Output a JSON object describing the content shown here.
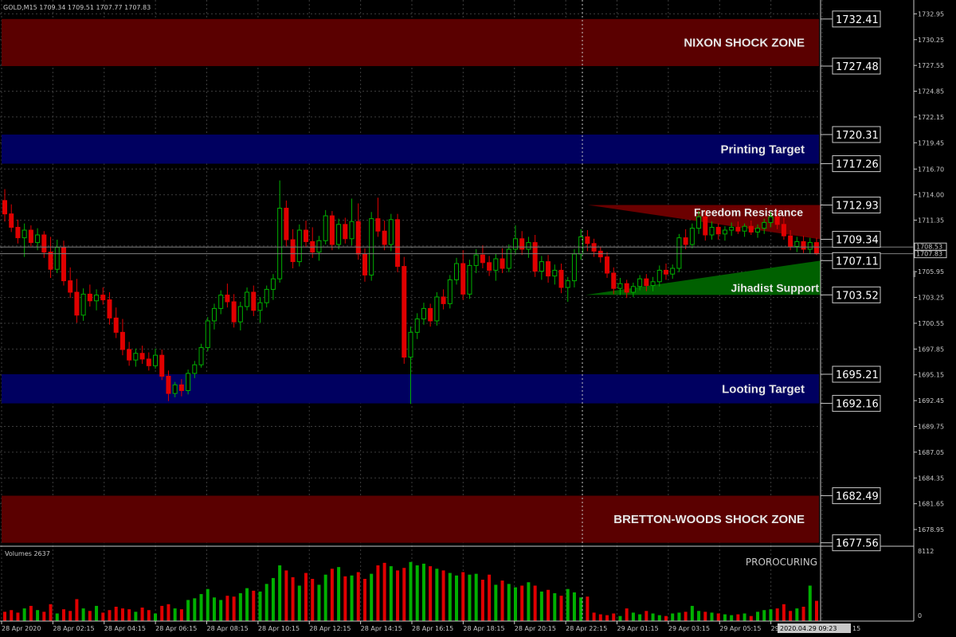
{
  "header": {
    "symbol_info": "GOLD,M15  1709.34 1709.51 1707.77 1707.83"
  },
  "volume_panel": {
    "title": "Volumes 2637",
    "max_label": "8112",
    "zero_label": "0",
    "indicator_label": "PROROCURING"
  },
  "price_axis": {
    "ticks": [
      "1732.95",
      "1730.25",
      "1727.55",
      "1724.85",
      "1722.15",
      "1719.45",
      "1716.70",
      "1714.00",
      "1711.35",
      "1708.65",
      "1705.95",
      "1703.25",
      "1700.55",
      "1697.85",
      "1695.15",
      "1692.45",
      "1689.75",
      "1687.05",
      "1684.35",
      "1681.65",
      "1678.95"
    ],
    "tick_values": [
      1732.95,
      1730.25,
      1727.55,
      1724.85,
      1722.15,
      1719.45,
      1716.7,
      1714.0,
      1711.35,
      1708.65,
      1705.95,
      1703.25,
      1700.55,
      1697.85,
      1695.15,
      1692.45,
      1689.75,
      1687.05,
      1684.35,
      1681.65,
      1678.95
    ],
    "current_bid": "1708.53",
    "current_ask": "1707.83",
    "range": [
      1677.2,
      1734.4
    ]
  },
  "time_axis": {
    "labels": [
      "28 Apr 2020",
      "28 Apr 02:15",
      "28 Apr 04:15",
      "28 Apr 06:15",
      "28 Apr 08:15",
      "28 Apr 10:15",
      "28 Apr 12:15",
      "28 Apr 14:15",
      "28 Apr 16:15",
      "28 Apr 18:15",
      "28 Apr 20:15",
      "28 Apr 22:15",
      "29 Apr 01:15",
      "29 Apr 03:15",
      "29 Apr 05:15",
      "29 Apr"
    ],
    "cursor_time": "2020.04.29 09:23",
    "trailing": "15"
  },
  "zones": [
    {
      "name": "NIXON SHOCK ZONE",
      "top": 1732.41,
      "bottom": 1727.48,
      "top_label": "1732.41",
      "bottom_label": "1727.48",
      "color": "#5a0000"
    },
    {
      "name": "Printing Target",
      "top": 1720.31,
      "bottom": 1717.26,
      "top_label": "1720.31",
      "bottom_label": "1717.26",
      "color": "#000060"
    },
    {
      "name": "Looting Target",
      "top": 1695.21,
      "bottom": 1692.16,
      "top_label": "1695.21",
      "bottom_label": "1692.16",
      "color": "#000060"
    },
    {
      "name": "BRETTON-WOODS SHOCK ZONE",
      "top": 1682.49,
      "bottom": 1677.56,
      "top_label": "1682.49",
      "bottom_label": "1677.56",
      "color": "#5a0000"
    }
  ],
  "triangles": [
    {
      "name": "Freedom Resistance",
      "top": 1712.93,
      "top_label": "1712.93",
      "mid": 1709.34,
      "mid_label": "1709.34",
      "color": "#6b0000"
    },
    {
      "name": "Jihadist Support",
      "bottom": 1703.52,
      "bottom_label": "1703.52",
      "mid": 1707.11,
      "mid_label": "1707.11",
      "color": "#006000"
    }
  ],
  "chart_data": {
    "type": "candlestick",
    "title": "GOLD,M15",
    "timeframe": "M15",
    "ylim": [
      1677.2,
      1734.4
    ],
    "ohlc": [
      [
        1713.4,
        1714.6,
        1711.2,
        1712.0
      ],
      [
        1712.0,
        1713.0,
        1710.1,
        1710.6
      ],
      [
        1710.6,
        1711.4,
        1708.9,
        1709.5
      ],
      [
        1709.5,
        1711.0,
        1707.5,
        1710.3
      ],
      [
        1710.3,
        1710.8,
        1708.6,
        1709.0
      ],
      [
        1709.0,
        1710.5,
        1708.2,
        1709.8
      ],
      [
        1709.8,
        1710.2,
        1707.4,
        1708.0
      ],
      [
        1708.0,
        1709.6,
        1705.3,
        1706.2
      ],
      [
        1706.2,
        1709.3,
        1705.8,
        1708.5
      ],
      [
        1708.5,
        1709.2,
        1704.5,
        1705.0
      ],
      [
        1705.0,
        1706.4,
        1703.2,
        1703.8
      ],
      [
        1703.8,
        1705.2,
        1700.6,
        1701.4
      ],
      [
        1701.4,
        1704.2,
        1700.8,
        1703.6
      ],
      [
        1703.6,
        1704.6,
        1702.3,
        1702.9
      ],
      [
        1702.9,
        1704.1,
        1701.9,
        1703.5
      ],
      [
        1703.5,
        1704.3,
        1702.5,
        1703.0
      ],
      [
        1703.0,
        1703.8,
        1700.4,
        1701.1
      ],
      [
        1701.1,
        1702.2,
        1699.0,
        1699.6
      ],
      [
        1699.6,
        1701.0,
        1697.2,
        1697.8
      ],
      [
        1697.8,
        1698.6,
        1696.1,
        1696.7
      ],
      [
        1696.7,
        1697.9,
        1696.0,
        1697.4
      ],
      [
        1697.4,
        1698.2,
        1696.3,
        1696.8
      ],
      [
        1696.8,
        1697.5,
        1695.6,
        1696.1
      ],
      [
        1696.1,
        1697.9,
        1695.8,
        1697.2
      ],
      [
        1697.2,
        1697.8,
        1694.6,
        1695.0
      ],
      [
        1695.0,
        1695.6,
        1692.4,
        1693.2
      ],
      [
        1693.2,
        1694.4,
        1692.8,
        1694.1
      ],
      [
        1694.1,
        1694.7,
        1692.9,
        1693.5
      ],
      [
        1693.5,
        1695.7,
        1693.1,
        1695.3
      ],
      [
        1695.3,
        1696.6,
        1694.8,
        1696.2
      ],
      [
        1696.2,
        1698.4,
        1695.9,
        1698.0
      ],
      [
        1698.0,
        1701.2,
        1697.6,
        1700.8
      ],
      [
        1700.8,
        1702.6,
        1699.9,
        1702.1
      ],
      [
        1702.1,
        1704.0,
        1701.5,
        1703.5
      ],
      [
        1703.5,
        1704.7,
        1702.2,
        1702.8
      ],
      [
        1702.8,
        1703.6,
        1700.1,
        1700.7
      ],
      [
        1700.7,
        1702.8,
        1699.8,
        1702.3
      ],
      [
        1702.3,
        1704.3,
        1701.9,
        1703.8
      ],
      [
        1703.8,
        1704.5,
        1701.3,
        1701.9
      ],
      [
        1701.9,
        1703.3,
        1700.6,
        1702.7
      ],
      [
        1702.7,
        1704.5,
        1702.2,
        1704.1
      ],
      [
        1704.1,
        1705.7,
        1703.0,
        1705.2
      ],
      [
        1705.2,
        1715.5,
        1704.8,
        1712.6
      ],
      [
        1712.6,
        1713.4,
        1708.6,
        1709.3
      ],
      [
        1709.3,
        1710.4,
        1706.3,
        1707.0
      ],
      [
        1707.0,
        1710.9,
        1706.5,
        1710.3
      ],
      [
        1710.3,
        1711.3,
        1708.5,
        1709.1
      ],
      [
        1709.1,
        1710.6,
        1707.4,
        1708.0
      ],
      [
        1708.0,
        1709.7,
        1707.1,
        1709.2
      ],
      [
        1709.2,
        1712.4,
        1708.8,
        1711.8
      ],
      [
        1711.8,
        1712.3,
        1708.2,
        1708.8
      ],
      [
        1708.8,
        1711.5,
        1708.3,
        1710.9
      ],
      [
        1710.9,
        1711.6,
        1708.9,
        1709.4
      ],
      [
        1709.4,
        1713.6,
        1708.7,
        1711.2
      ],
      [
        1711.2,
        1713.1,
        1707.2,
        1707.8
      ],
      [
        1707.8,
        1708.4,
        1704.9,
        1705.6
      ],
      [
        1705.6,
        1712.2,
        1705.0,
        1711.5
      ],
      [
        1711.5,
        1713.7,
        1709.6,
        1710.2
      ],
      [
        1710.2,
        1711.3,
        1708.2,
        1708.8
      ],
      [
        1708.8,
        1712.0,
        1708.1,
        1711.4
      ],
      [
        1711.4,
        1712.0,
        1705.9,
        1706.5
      ],
      [
        1706.5,
        1707.5,
        1696.3,
        1697.0
      ],
      [
        1697.0,
        1700.2,
        1692.1,
        1699.6
      ],
      [
        1699.6,
        1701.6,
        1698.9,
        1701.0
      ],
      [
        1701.0,
        1702.7,
        1700.4,
        1702.1
      ],
      [
        1702.1,
        1702.6,
        1700.2,
        1700.8
      ],
      [
        1700.8,
        1703.8,
        1700.3,
        1703.3
      ],
      [
        1703.3,
        1704.1,
        1702.0,
        1702.6
      ],
      [
        1702.6,
        1705.6,
        1702.1,
        1705.1
      ],
      [
        1705.1,
        1707.4,
        1704.6,
        1706.8
      ],
      [
        1706.8,
        1708.2,
        1703.0,
        1703.6
      ],
      [
        1703.6,
        1707.2,
        1703.1,
        1706.6
      ],
      [
        1706.6,
        1708.3,
        1705.8,
        1707.7
      ],
      [
        1707.7,
        1708.7,
        1706.3,
        1706.9
      ],
      [
        1706.9,
        1707.6,
        1705.5,
        1706.1
      ],
      [
        1706.1,
        1707.8,
        1705.0,
        1707.3
      ],
      [
        1707.3,
        1708.4,
        1705.8,
        1706.3
      ],
      [
        1706.3,
        1708.8,
        1705.9,
        1708.3
      ],
      [
        1708.3,
        1710.8,
        1707.7,
        1709.4
      ],
      [
        1709.4,
        1710.2,
        1707.7,
        1708.3
      ],
      [
        1708.3,
        1709.6,
        1707.4,
        1709.0
      ],
      [
        1709.0,
        1709.8,
        1705.4,
        1706.0
      ],
      [
        1706.0,
        1707.6,
        1705.1,
        1707.0
      ],
      [
        1707.0,
        1707.7,
        1704.8,
        1705.5
      ],
      [
        1705.5,
        1706.7,
        1704.6,
        1706.1
      ],
      [
        1706.1,
        1706.8,
        1703.7,
        1704.3
      ],
      [
        1704.3,
        1705.4,
        1702.8,
        1705.0
      ],
      [
        1705.0,
        1708.3,
        1704.3,
        1707.8
      ],
      [
        1707.8,
        1710.4,
        1707.2,
        1709.6
      ],
      [
        1709.6,
        1710.3,
        1708.1,
        1708.9
      ],
      [
        1708.9,
        1709.4,
        1707.5,
        1708.1
      ],
      [
        1708.1,
        1708.6,
        1706.9,
        1707.5
      ],
      [
        1707.5,
        1708.0,
        1705.3,
        1705.8
      ],
      [
        1705.8,
        1706.4,
        1703.6,
        1704.2
      ],
      [
        1704.2,
        1705.3,
        1703.5,
        1704.7
      ],
      [
        1704.7,
        1705.1,
        1703.2,
        1703.8
      ],
      [
        1703.8,
        1704.8,
        1703.3,
        1704.4
      ],
      [
        1704.4,
        1705.6,
        1704.0,
        1705.2
      ],
      [
        1705.2,
        1705.7,
        1703.9,
        1704.5
      ],
      [
        1704.5,
        1705.4,
        1703.9,
        1704.9
      ],
      [
        1704.9,
        1706.6,
        1704.4,
        1706.1
      ],
      [
        1706.1,
        1706.8,
        1705.1,
        1705.7
      ],
      [
        1705.7,
        1706.7,
        1705.2,
        1706.3
      ],
      [
        1706.3,
        1709.9,
        1705.9,
        1709.5
      ],
      [
        1709.5,
        1710.4,
        1708.3,
        1708.8
      ],
      [
        1708.8,
        1711.0,
        1708.4,
        1710.5
      ],
      [
        1710.5,
        1712.3,
        1709.9,
        1711.7
      ],
      [
        1711.7,
        1712.4,
        1709.2,
        1709.8
      ],
      [
        1709.8,
        1711.2,
        1709.3,
        1710.6
      ],
      [
        1710.6,
        1711.0,
        1709.3,
        1709.9
      ],
      [
        1709.9,
        1710.7,
        1709.2,
        1710.3
      ],
      [
        1710.3,
        1711.1,
        1709.7,
        1710.6
      ],
      [
        1710.6,
        1711.2,
        1709.9,
        1710.2
      ],
      [
        1710.2,
        1711.0,
        1709.6,
        1710.7
      ],
      [
        1710.7,
        1711.3,
        1709.8,
        1710.1
      ],
      [
        1710.1,
        1710.9,
        1709.5,
        1710.5
      ],
      [
        1710.5,
        1711.5,
        1709.9,
        1711.1
      ],
      [
        1711.1,
        1712.2,
        1710.6,
        1711.7
      ],
      [
        1711.7,
        1712.4,
        1710.4,
        1710.9
      ],
      [
        1710.9,
        1711.6,
        1709.3,
        1709.7
      ],
      [
        1709.7,
        1710.3,
        1708.2,
        1708.6
      ],
      [
        1708.6,
        1709.6,
        1708.0,
        1709.1
      ],
      [
        1709.1,
        1709.7,
        1707.9,
        1708.3
      ],
      [
        1708.3,
        1709.5,
        1707.8,
        1709.0
      ],
      [
        1709.0,
        1709.5,
        1707.7,
        1707.83
      ]
    ],
    "volumes": [
      1100,
      1300,
      1000,
      1500,
      1800,
      1300,
      1100,
      2000,
      900,
      1400,
      1200,
      2600,
      1500,
      1200,
      1800,
      1000,
      1300,
      1700,
      1500,
      1400,
      1100,
      1600,
      1300,
      900,
      1800,
      2000,
      1500,
      1400,
      2500,
      2700,
      3200,
      3800,
      2800,
      2500,
      3000,
      2900,
      3300,
      3900,
      3600,
      3500,
      4400,
      5100,
      6600,
      6000,
      5200,
      4200,
      5700,
      5000,
      4300,
      5500,
      6200,
      6400,
      5300,
      5400,
      5800,
      5000,
      5600,
      6600,
      6900,
      6500,
      6000,
      6300,
      7000,
      6600,
      6800,
      6500,
      6200,
      6000,
      5700,
      5400,
      5800,
      5500,
      5600,
      4900,
      5500,
      4300,
      4800,
      4400,
      4000,
      4200,
      4600,
      4200,
      3500,
      3700,
      3300,
      3000,
      3800,
      3400,
      2800,
      2900,
      1000,
      800,
      700,
      900,
      600,
      1500,
      1000,
      800,
      1200,
      900,
      700,
      600,
      900,
      1000,
      1100,
      1800,
      1200,
      1100,
      1000,
      900,
      800,
      700,
      800,
      900,
      600,
      1100,
      1300,
      1400,
      1500,
      2000,
      1200,
      1500,
      1700,
      4200,
      2400
    ]
  },
  "colors": {
    "background": "#000000",
    "grid": "#3c3c3c",
    "axis_text": "#c8c8c8",
    "bull": "#00b000",
    "bear": "#e00000",
    "wick_bull": "#00b000",
    "wick_bear": "#e00000",
    "price_line": "#808080"
  }
}
